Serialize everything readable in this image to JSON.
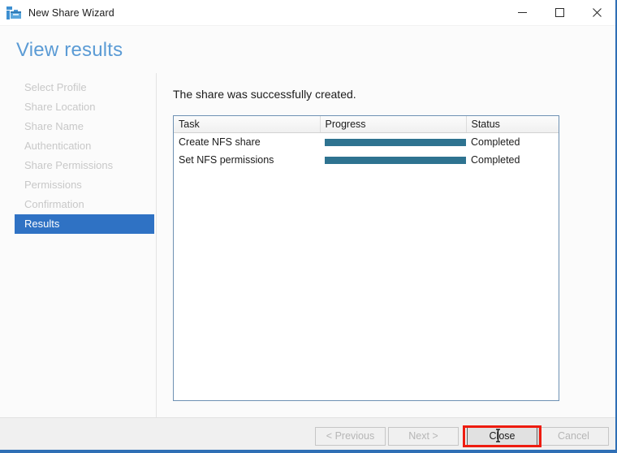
{
  "window": {
    "title": "New Share Wizard",
    "icon": "share-folder-icon",
    "controls": {
      "minimize": "─",
      "maximize": "□",
      "close": "✕"
    }
  },
  "header": {
    "page_title": "View results",
    "accent_color": "#5b9bd5"
  },
  "sidebar": {
    "items": [
      {
        "label": "Select Profile",
        "active": false
      },
      {
        "label": "Share Location",
        "active": false
      },
      {
        "label": "Share Name",
        "active": false
      },
      {
        "label": "Authentication",
        "active": false
      },
      {
        "label": "Share Permissions",
        "active": false
      },
      {
        "label": "Permissions",
        "active": false
      },
      {
        "label": "Confirmation",
        "active": false
      },
      {
        "label": "Results",
        "active": true
      }
    ],
    "active_bg": "#2f72c4",
    "inactive_color": "#c8c8c8"
  },
  "main": {
    "heading": "The share was successfully created.",
    "table": {
      "columns": [
        "Task",
        "Progress",
        "Status"
      ],
      "rows": [
        {
          "task": "Create NFS share",
          "progress": 100,
          "status": "Completed"
        },
        {
          "task": "Set NFS permissions",
          "progress": 100,
          "status": "Completed"
        }
      ],
      "progress_color": "#2e7390"
    }
  },
  "footer": {
    "buttons": [
      {
        "label": "< Previous",
        "state": "disabled"
      },
      {
        "label": "Next >",
        "state": "disabled"
      },
      {
        "label": "Close",
        "state": "default"
      },
      {
        "label": "Cancel",
        "state": "disabled"
      }
    ]
  },
  "annotation": {
    "target": "Close",
    "color": "#ee1c10"
  }
}
